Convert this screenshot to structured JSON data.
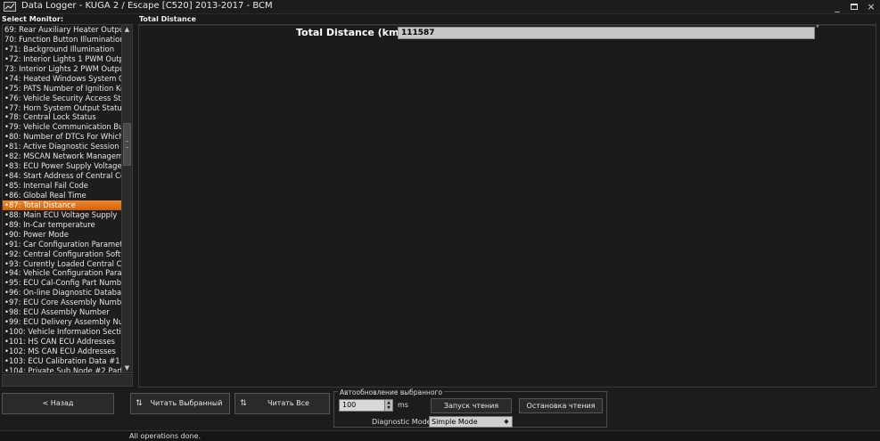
{
  "window": {
    "title": "Data Logger - KUGA 2 / Escape [C520] 2013-2017 - BCM",
    "minimize_glyph": "_",
    "close_glyph": "×"
  },
  "left": {
    "label": "Select Monitor:",
    "items": [
      "69: Rear Auxiliary Heater Outpu",
      "70: Function Button Illumination",
      "•71: Background Illumination",
      "•72: Interior Lights 1 PWM Outp",
      "73: Interior Lights 2 PWM Outpu",
      "•74: Heated Windows System O",
      "•75: PATS Number of Ignition Ke",
      "•76: Vehicle Security Access Sta",
      "•77: Horn System Output Status",
      "•78: Central Lock Status",
      "•79: Vehicle Communication Bus",
      "•80: Number of DTCs For Which",
      "•81: Active Diagnostic Session",
      "•82: MSCAN Network Managem",
      "•83: ECU Power Supply Voltage",
      "•84: Start Address of Central Co",
      "•85: Internal Fail Code",
      "•86: Global Real Time",
      "•87: Total Distance",
      "•88: Main ECU Voltage Supply",
      "•89: In-Car temperature",
      "•90: Power Mode",
      "•91: Car Configuration Paramete",
      "•92: Central Configuration Softw",
      "•93: Curently Loaded Central Co",
      "•94: Vehicle Configuration Paran",
      "•95: ECU Cal-Config Part Numbe",
      "•96: On-line Diagnostic Databas",
      "•97: ECU Core Assembly Numbe",
      "•98: ECU Assembly Number",
      "•99: ECU Delivery Assembly Nur",
      "•100: Vehicle Information Sectio",
      "•101: HS CAN ECU Addresses",
      "•102: MS CAN ECU Addresses",
      "•103: ECU Calibration Data #1 N",
      "•104: Private Sub Node #2 Part"
    ],
    "selected_index": 18
  },
  "main": {
    "label": "Total Distance",
    "total_distance_label": "Total Distance (km):",
    "total_distance_value": "111587",
    "degree_mark": "°"
  },
  "bottom": {
    "back_label": "< Назад",
    "read_selected_label": "Читать Выбранный",
    "read_all_label": "Читать Все",
    "auto_update_legend": "Автообновление выбранного",
    "interval_value": "100",
    "interval_unit": "ms",
    "start_label": "Запуск чтения",
    "stop_label": "Остановка чтения",
    "diag_mode_label": "Diagnostic Mode:",
    "diag_mode_value": "Simple Mode"
  },
  "status": {
    "text": "All operations done."
  },
  "colors": {
    "selected_item": "#e5761a",
    "background": "#1a1a1a"
  }
}
